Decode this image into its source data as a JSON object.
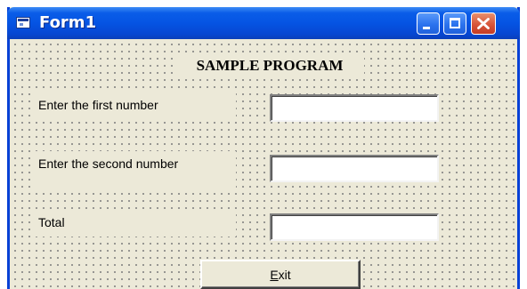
{
  "window": {
    "title": "Form1",
    "icon": "form-app-icon",
    "controls": {
      "minimize_icon": "minimize-icon",
      "maximize_icon": "maximize-icon",
      "close_icon": "close-icon"
    }
  },
  "form": {
    "heading": "SAMPLE PROGRAM",
    "fields": [
      {
        "label": "Enter the first number",
        "value": ""
      },
      {
        "label": "Enter the second number",
        "value": ""
      },
      {
        "label": "Total",
        "value": ""
      }
    ],
    "exit_button": {
      "access_key": "E",
      "rest": "xit"
    }
  },
  "colors": {
    "title_bar": "#0554e3",
    "close_button": "#d8553a",
    "form_background": "#ece9d8"
  }
}
